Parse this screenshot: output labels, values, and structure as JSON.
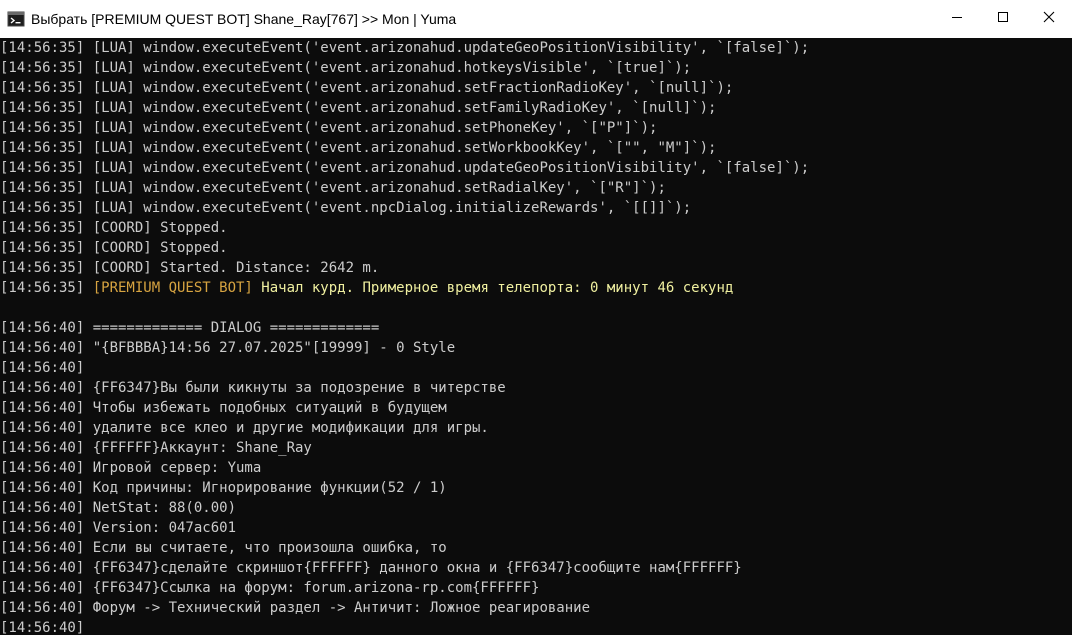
{
  "window": {
    "title": "Выбрать [PREMIUM QUEST BOT] Shane_Ray[767] >> Mon | Yuma",
    "icon": "console-icon",
    "controls": [
      "minimize-icon",
      "maximize-icon",
      "close-icon"
    ]
  },
  "colors": {
    "background": "#0c0c0c",
    "text": "#cccccc",
    "accent": "#d7a441",
    "emphasis": "#f0f0a0",
    "titlebar": "#ffffff"
  },
  "console": {
    "lines": [
      [
        {
          "t": "[14:56:35] [LUA] window.executeEvent('event.arizonahud.updateGeoPositionVisibility', `[false]`);"
        }
      ],
      [
        {
          "t": "[14:56:35] [LUA] window.executeEvent('event.arizonahud.hotkeysVisible', `[true]`);"
        }
      ],
      [
        {
          "t": "[14:56:35] [LUA] window.executeEvent('event.arizonahud.setFractionRadioKey', `[null]`);"
        }
      ],
      [
        {
          "t": "[14:56:35] [LUA] window.executeEvent('event.arizonahud.setFamilyRadioKey', `[null]`);"
        }
      ],
      [
        {
          "t": "[14:56:35] [LUA] window.executeEvent('event.arizonahud.setPhoneKey', `[\"P\"]`);"
        }
      ],
      [
        {
          "t": "[14:56:35] [LUA] window.executeEvent('event.arizonahud.setWorkbookKey', `[\"\", \"M\"]`);"
        }
      ],
      [
        {
          "t": "[14:56:35] [LUA] window.executeEvent('event.arizonahud.updateGeoPositionVisibility', `[false]`);"
        }
      ],
      [
        {
          "t": "[14:56:35] [LUA] window.executeEvent('event.arizonahud.setRadialKey', `[\"R\"]`);"
        }
      ],
      [
        {
          "t": "[14:56:35] [LUA] window.executeEvent('event.npcDialog.initializeRewards', `[[]]`);"
        }
      ],
      [
        {
          "t": "[14:56:35] [COORD] Stopped."
        }
      ],
      [
        {
          "t": "[14:56:35] [COORD] Stopped."
        }
      ],
      [
        {
          "t": "[14:56:35] [COORD] Started. Distance: 2642 m."
        }
      ],
      [
        {
          "t": "[14:56:35] "
        },
        {
          "t": "[PREMIUM QUEST BOT]",
          "c": "accent"
        },
        {
          "t": " Начал курд. Примерное время телепорта: 0 минут 46 секунд",
          "c": "emph"
        }
      ],
      [
        {
          "t": ""
        }
      ],
      [
        {
          "t": "[14:56:40] ============= DIALOG ============="
        }
      ],
      [
        {
          "t": "[14:56:40] \"{BFBBBA}14:56 27.07.2025\"[19999] - 0 Style"
        }
      ],
      [
        {
          "t": "[14:56:40]"
        }
      ],
      [
        {
          "t": "[14:56:40] {FF6347}Вы были кикнуты за подозрение в читерстве"
        }
      ],
      [
        {
          "t": "[14:56:40] Чтобы избежать подобных ситуаций в будущем"
        }
      ],
      [
        {
          "t": "[14:56:40] удалите все клео и другие модификации для игры."
        }
      ],
      [
        {
          "t": "[14:56:40] {FFFFFF}Аккаунт: Shane_Ray"
        }
      ],
      [
        {
          "t": "[14:56:40] Игровой сервер: Yuma"
        }
      ],
      [
        {
          "t": "[14:56:40] Код причины: Игнорирование функции(52 / 1)"
        }
      ],
      [
        {
          "t": "[14:56:40] NetStat: 88(0.00)"
        }
      ],
      [
        {
          "t": "[14:56:40] Version: 047ac601"
        }
      ],
      [
        {
          "t": "[14:56:40] Если вы считаете, что произошла ошибка, то"
        }
      ],
      [
        {
          "t": "[14:56:40] {FF6347}сделайте скриншот{FFFFFF} данного окна и {FF6347}сообщите нам{FFFFFF}"
        }
      ],
      [
        {
          "t": "[14:56:40] {FF6347}Ссылка на форум: forum.arizona-rp.com{FFFFFF}"
        }
      ],
      [
        {
          "t": "[14:56:40] Форум -> Технический раздел -> Античит: Ложное реагирование"
        }
      ],
      [
        {
          "t": "[14:56:40]"
        }
      ]
    ]
  }
}
